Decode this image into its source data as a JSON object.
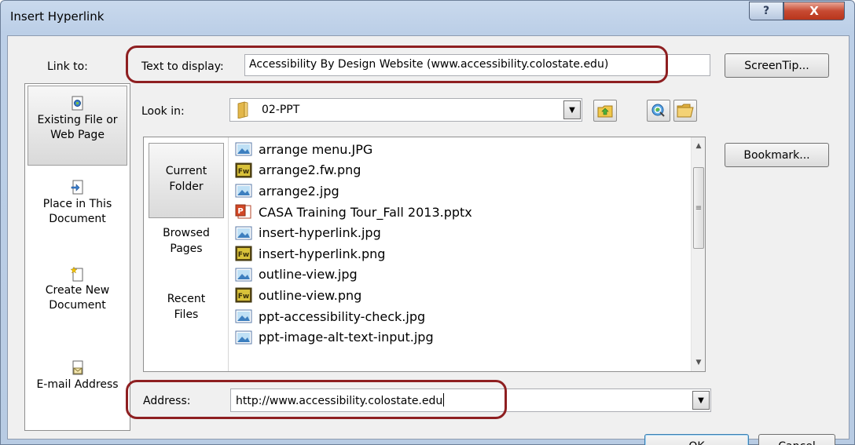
{
  "window": {
    "title": "Insert Hyperlink",
    "help_glyph": "?",
    "close_glyph": "X"
  },
  "link_to": {
    "label": "Link to:",
    "items": [
      {
        "label_line1": "Existing File or",
        "label_line2": "Web Page",
        "active": true
      },
      {
        "label_line1": "Place in This",
        "label_line2": "Document",
        "active": false
      },
      {
        "label_line1": "Create New",
        "label_line2": "Document",
        "active": false
      },
      {
        "label_line1": "E-mail Address",
        "label_line2": "",
        "active": false
      }
    ]
  },
  "text_to_display": {
    "label": "Text to display:",
    "value": "Accessibility By Design Website (www.accessibility.colostate.edu)"
  },
  "buttons": {
    "screentip": "ScreenTip...",
    "bookmark": "Bookmark...",
    "ok": "OK",
    "cancel": "Cancel"
  },
  "look_in": {
    "label": "Look in:",
    "value": "02-PPT"
  },
  "nav": {
    "current_folder_1": "Current",
    "current_folder_2": "Folder",
    "browsed_pages_1": "Browsed",
    "browsed_pages_2": "Pages",
    "recent_files_1": "Recent",
    "recent_files_2": "Files"
  },
  "files": [
    {
      "name": "arrange menu.JPG",
      "icon": "image-icon"
    },
    {
      "name": "arrange2.fw.png",
      "icon": "fireworks-icon"
    },
    {
      "name": "arrange2.jpg",
      "icon": "image-icon"
    },
    {
      "name": "CASA Training Tour_Fall 2013.pptx",
      "icon": "powerpoint-icon"
    },
    {
      "name": "insert-hyperlink.jpg",
      "icon": "image-icon"
    },
    {
      "name": "insert-hyperlink.png",
      "icon": "fireworks-icon"
    },
    {
      "name": "outline-view.jpg",
      "icon": "image-icon"
    },
    {
      "name": "outline-view.png",
      "icon": "fireworks-icon"
    },
    {
      "name": "ppt-accessibility-check.jpg",
      "icon": "image-icon"
    },
    {
      "name": "ppt-image-alt-text-input.jpg",
      "icon": "image-icon"
    }
  ],
  "address": {
    "label": "Address:",
    "value": "http://www.accessibility.colostate.edu"
  },
  "colors": {
    "highlight": "#8e1f21",
    "close_button": "#c74a32",
    "title_bar": "#c9d9ed"
  }
}
